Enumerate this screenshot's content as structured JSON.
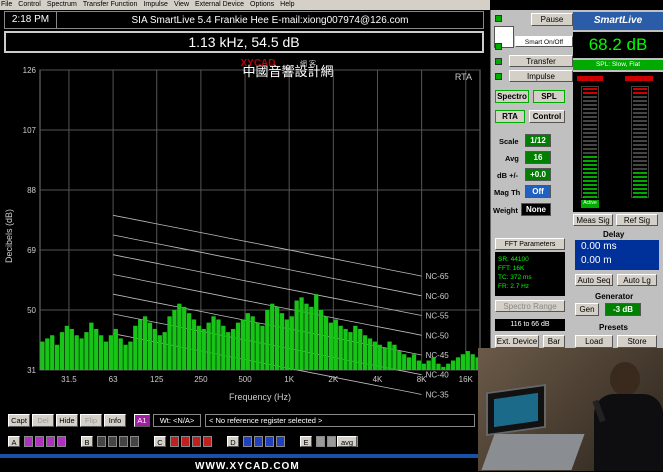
{
  "menu": [
    "File",
    "Control",
    "Spectrum",
    "Transfer Function",
    "Impulse",
    "View",
    "External Device",
    "Options",
    "Help"
  ],
  "title": {
    "time": "2:18 PM",
    "text": "SIA SmartLive  5.4   Frankie Hee   E-mail:xiong007974@126.com"
  },
  "readout": "1.13 kHz, 54.5 dB",
  "plot": {
    "banner": "中國音響設計網",
    "watermark": "XYCAD",
    "watermark_sub": "網 客",
    "mode": "RTA",
    "ylabel": "Decibels (dB)",
    "xlabel": "Frequency (Hz)",
    "yticks": [
      "126",
      "107",
      "88",
      "69",
      "50",
      "31"
    ],
    "xticks": [
      "31.5",
      "63",
      "125",
      "250",
      "500",
      "1K",
      "2K",
      "4K",
      "8K",
      "16K"
    ],
    "nc": [
      "NC-65",
      "NC-60",
      "NC-55",
      "NC-50",
      "NC-45",
      "NC-40",
      "NC-35"
    ]
  },
  "chart_data": {
    "type": "bar",
    "title": "",
    "xlabel": "Frequency (Hz)",
    "ylabel": "Decibels (dB)",
    "ylim": [
      31,
      126
    ],
    "xscale": "log",
    "x_range": [
      20,
      20000
    ],
    "series": [
      {
        "name": "",
        "values": [
          40,
          41,
          42,
          39,
          43,
          45,
          44,
          42,
          41,
          43,
          46,
          44,
          42,
          40,
          42,
          44,
          41,
          39,
          40,
          45,
          47,
          48,
          46,
          44,
          42,
          43,
          48,
          50,
          52,
          51,
          49,
          47,
          45,
          44,
          46,
          48,
          47,
          45,
          43,
          44,
          46,
          47,
          49,
          48,
          46,
          45,
          50,
          52,
          51,
          49,
          47,
          48,
          53,
          54,
          52,
          51,
          55,
          50,
          48,
          46,
          47,
          45,
          44,
          43,
          45,
          44,
          42,
          41,
          40,
          39,
          38,
          40,
          39,
          37,
          36,
          35,
          36,
          34,
          33,
          34,
          35,
          33,
          32,
          33,
          34,
          35,
          36,
          37,
          36,
          35
        ]
      }
    ]
  },
  "right": {
    "pause": "Pause",
    "smart": "Smart On/Off",
    "transfer": "Transfer",
    "impulse": "Impulse",
    "logo": "SmartLive",
    "spl_value": "68.2 dB",
    "spl_mode": "SPL: Slow, Flat",
    "spectro": "Spectro",
    "spl": "SPL",
    "rta": "RTA",
    "control": "Control",
    "scale_l": "Scale",
    "scale_v": "1/12",
    "avg_l": "Avg",
    "avg_v": "16",
    "db_l": "dB +/-",
    "db_v": "+0.0",
    "magth_l": "Mag Th",
    "magth_v": "Off",
    "weight_l": "Weight",
    "weight_v": "None",
    "meas": "Meas Sig",
    "ref": "Ref Sig",
    "delay": "Delay",
    "delay_ms": "0.00 ms",
    "delay_m": "0.00 m",
    "autoseq": "Auto Seq",
    "autolg": "Auto Lg",
    "generator": "Generator",
    "gen": "Gen",
    "gen_v": "-3 dB",
    "presets": "Presets",
    "load": "Load",
    "store": "Store",
    "fft_title": "FFT Parameters",
    "fft": [
      "SR: 44100",
      "FFT: 16K",
      "TC: 372 ms",
      "FR: 2.7 Hz"
    ],
    "spectro_range": "Spectro Range",
    "range": "116 to 66 dB",
    "extdev": "Ext. Device",
    "bar": "Bar",
    "active": "Active"
  },
  "bottom": {
    "capt": "Capt",
    "del": "Del",
    "hide": "Hide",
    "flip": "Flip",
    "info": "Info",
    "a1": "A1",
    "wt": "Wt: <N/A>",
    "ref": "< No reference register selected >",
    "regs": [
      "A",
      "B",
      "C",
      "D",
      "E"
    ],
    "avg": "avg",
    "footer": "WWW.XYCAD.COM"
  },
  "colors": {
    "bar": "#18c418",
    "led_on": "#00c000",
    "button": "#d4d0c8",
    "value_bg": "#008000"
  }
}
